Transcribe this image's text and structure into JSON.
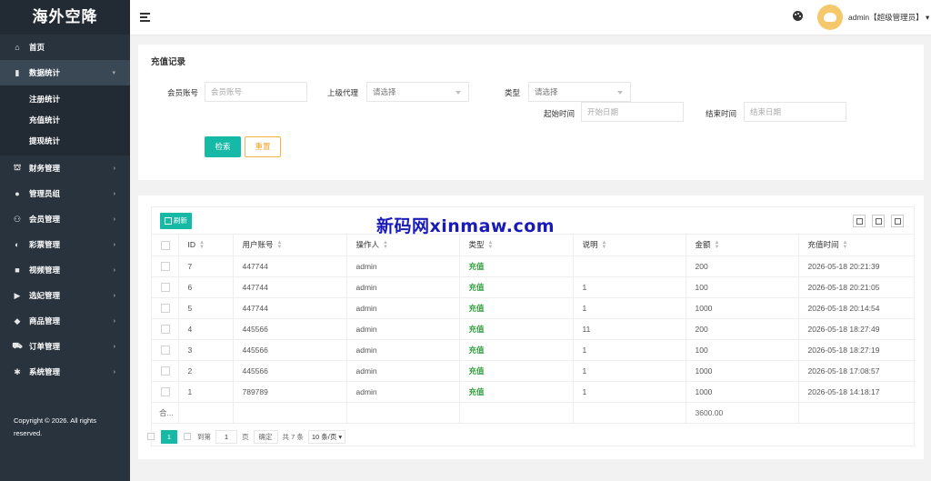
{
  "app": {
    "title": "海外空降"
  },
  "sidebar": {
    "items": [
      {
        "label": "首页",
        "icon": "home-icon",
        "glyph": "⌂"
      },
      {
        "label": "数据统计",
        "icon": "bar-chart-icon",
        "glyph": "▮",
        "open": true,
        "children": [
          "注册统计",
          "充值统计",
          "提现统计"
        ]
      },
      {
        "label": "财务管理",
        "icon": "bank-icon",
        "glyph": "⛫"
      },
      {
        "label": "管理员组",
        "icon": "user-icon",
        "glyph": "●"
      },
      {
        "label": "会员管理",
        "icon": "users-icon",
        "glyph": "⚇"
      },
      {
        "label": "彩票管理",
        "icon": "gamepad-icon",
        "glyph": "◐"
      },
      {
        "label": "视频管理",
        "icon": "video-icon",
        "glyph": "■"
      },
      {
        "label": "选妃管理",
        "icon": "camera-icon",
        "glyph": "▶"
      },
      {
        "label": "商品管理",
        "icon": "cube-icon",
        "glyph": "◆"
      },
      {
        "label": "订单管理",
        "icon": "cart-icon",
        "glyph": "⛟"
      },
      {
        "label": "系统管理",
        "icon": "gear-icon",
        "glyph": "✱"
      }
    ],
    "copyright": "Copyright © 2026. All rights reserved."
  },
  "header": {
    "username": "admin【超级管理员】 ▾"
  },
  "search": {
    "title": "充值记录",
    "member_label": "会员账号",
    "member_placeholder": "会员账号",
    "agent_label": "上级代理",
    "agent_value": "请选择",
    "type_label": "类型",
    "type_value": "请选择",
    "start_label": "起始时间",
    "start_placeholder": "开始日期",
    "end_label": "结束时间",
    "end_placeholder": "结束日期",
    "search_button": "检索",
    "reset_button": "重置"
  },
  "table": {
    "refresh_button": "刷新",
    "columns": [
      "ID",
      "用户账号",
      "操作人",
      "类型",
      "说明",
      "金额",
      "充值时间"
    ],
    "rows": [
      [
        "7",
        "447744",
        "admin",
        "充值",
        "",
        "200",
        "2026-05-18 20:21:39"
      ],
      [
        "6",
        "447744",
        "admin",
        "充值",
        "1",
        "100",
        "2026-05-18 20:21:05"
      ],
      [
        "5",
        "447744",
        "admin",
        "充值",
        "1",
        "1000",
        "2026-05-18 20:14:54"
      ],
      [
        "4",
        "445566",
        "admin",
        "充值",
        "11",
        "200",
        "2026-05-18 18:27:49"
      ],
      [
        "3",
        "445566",
        "admin",
        "充值",
        "1",
        "100",
        "2026-05-18 18:27:19"
      ],
      [
        "2",
        "445566",
        "admin",
        "充值",
        "1",
        "1000",
        "2026-05-18 17:08:57"
      ],
      [
        "1",
        "789789",
        "admin",
        "充值",
        "1",
        "1000",
        "2026-05-18 14:18:17"
      ]
    ],
    "total_label": "合...",
    "total_amount": "3600.00"
  },
  "pager": {
    "current": "1",
    "goto_label": "到第",
    "goto_value": "1",
    "page_unit": "页",
    "confirm": "确定",
    "total": "共 7 条",
    "page_size": "10 条/页 ▾"
  },
  "watermark": "新码网xinmaw.com"
}
